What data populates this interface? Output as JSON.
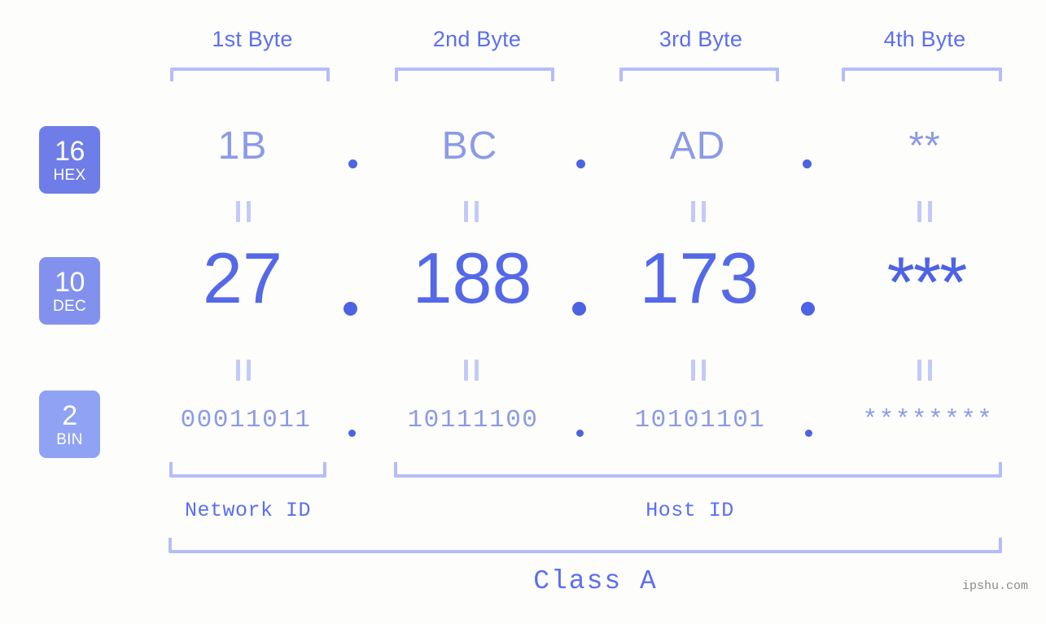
{
  "theme": {
    "background": "#fdfefb",
    "accent_strong": "#4c63e4",
    "accent_label": "#5b6ef2",
    "accent_soft": "#8b9ae8",
    "bracket": "#b4bdfb",
    "connector": "#c3caf9",
    "badge_hex": "#6f7de8",
    "badge_dec": "#8391ee",
    "badge_bin": "#8fa2f3",
    "watermark": "#8a8a8a"
  },
  "header": {
    "byte_labels": [
      "1st Byte",
      "2nd Byte",
      "3rd Byte",
      "4th Byte"
    ]
  },
  "rows": {
    "hex": {
      "badge_number": "16",
      "badge_name": "HEX",
      "values": [
        "1B",
        "BC",
        "AD",
        "**"
      ],
      "separator": "."
    },
    "dec": {
      "badge_number": "10",
      "badge_name": "DEC",
      "values": [
        "27",
        "188",
        "173",
        "***"
      ],
      "separator": "."
    },
    "bin": {
      "badge_number": "2",
      "badge_name": "BIN",
      "values": [
        "00011011",
        "10111100",
        "10101101",
        "********"
      ],
      "separator": "."
    }
  },
  "connectors": {
    "glyph": "equals-rotated"
  },
  "segments": {
    "network_id": "Network ID",
    "host_id": "Host ID",
    "class": "Class A"
  },
  "watermark": "ipshu.com"
}
